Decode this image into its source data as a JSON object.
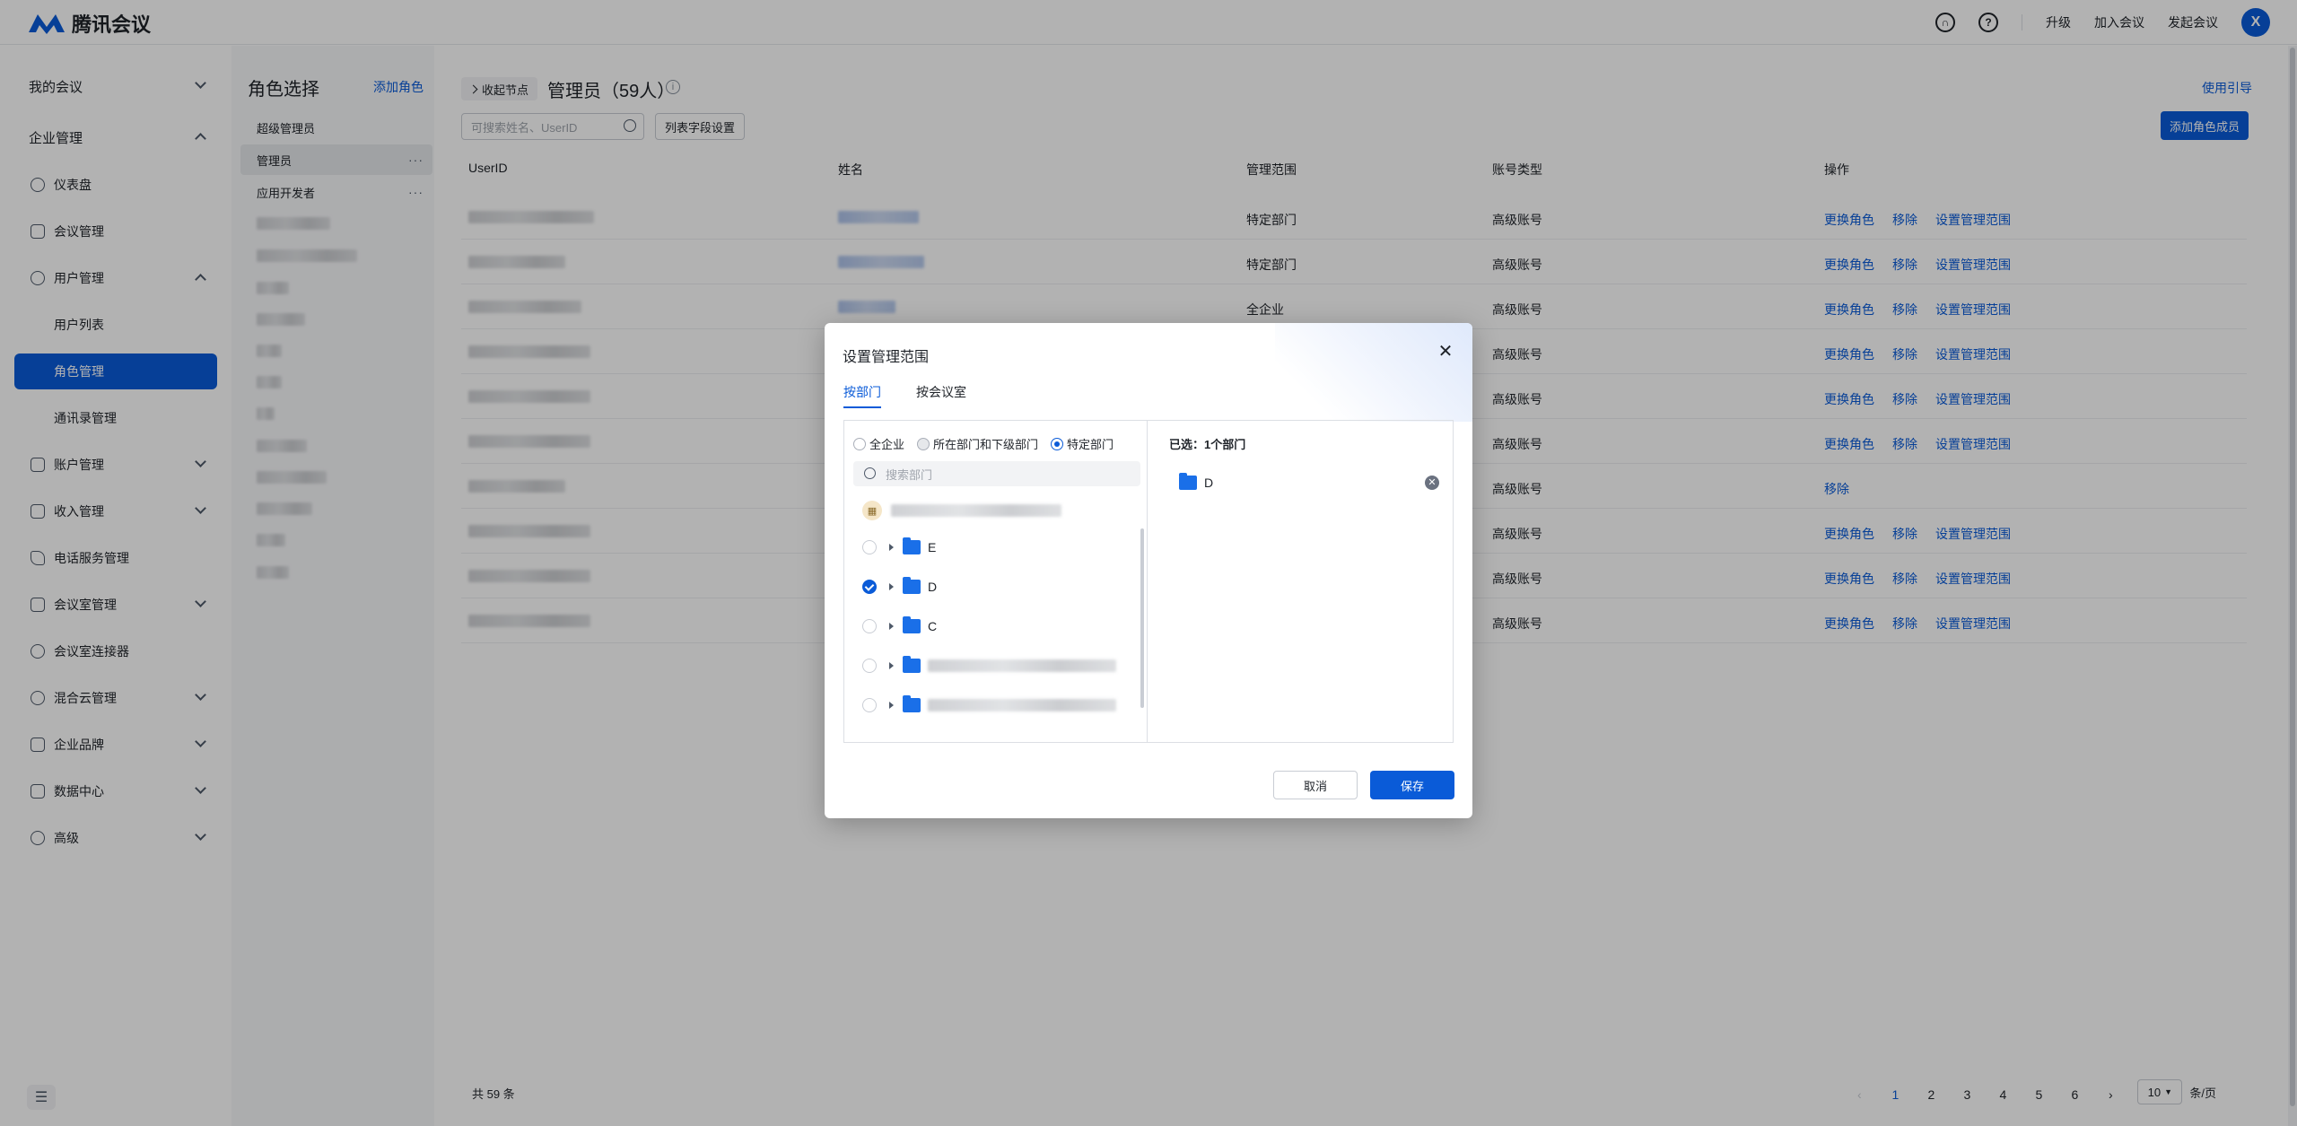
{
  "app": {
    "name": "腾讯会议",
    "brand_color": "#0a5bd8"
  },
  "topbar": {
    "icons": [
      "headset-icon",
      "help-icon"
    ],
    "upgrade": "升级",
    "join_meeting": "加入会议",
    "start_meeting": "发起会议",
    "avatar_letter": "X"
  },
  "sidebar": {
    "my_meetings": "我的会议",
    "enterprise_mgmt": "企业管理",
    "items": [
      {
        "label": "仪表盘",
        "icon": "dashboard-icon"
      },
      {
        "label": "会议管理",
        "icon": "list-icon"
      },
      {
        "label": "用户管理",
        "icon": "user-icon"
      },
      {
        "label": "用户列表"
      },
      {
        "label": "角色管理"
      },
      {
        "label": "通讯录管理"
      },
      {
        "label": "账户管理",
        "icon": "account-icon"
      },
      {
        "label": "收入管理",
        "icon": "income-icon"
      },
      {
        "label": "电话服务管理",
        "icon": "phone-icon"
      },
      {
        "label": "会议室管理",
        "icon": "room-icon"
      },
      {
        "label": "会议室连接器",
        "icon": "link-icon"
      },
      {
        "label": "混合云管理",
        "icon": "cloud-icon"
      },
      {
        "label": "企业品牌",
        "icon": "brand-icon"
      },
      {
        "label": "数据中心",
        "icon": "data-icon"
      },
      {
        "label": "高级",
        "icon": "advanced-icon"
      }
    ]
  },
  "roles": {
    "title": "角色选择",
    "add": "添加角色",
    "items": [
      "超级管理员",
      "管理员",
      "应用开发者"
    ]
  },
  "main": {
    "collapse_node": "收起节点",
    "title": "管理员（59人）",
    "use_guide": "使用引导",
    "search_placeholder": "可搜索姓名、UserID",
    "field_settings": "列表字段设置",
    "add_member": "添加角色成员",
    "columns": [
      "UserID",
      "姓名",
      "管理范围",
      "账号类型",
      "操作"
    ],
    "rows": [
      {
        "scope": "特定部门",
        "type": "高级账号",
        "ops": [
          "更换角色",
          "移除",
          "设置管理范围"
        ]
      },
      {
        "scope": "特定部门",
        "type": "高级账号",
        "ops": [
          "更换角色",
          "移除",
          "设置管理范围"
        ]
      },
      {
        "scope": "全企业",
        "type": "高级账号",
        "ops": [
          "更换角色",
          "移除",
          "设置管理范围"
        ]
      },
      {
        "scope": "",
        "type": "高级账号",
        "ops": [
          "更换角色",
          "移除",
          "设置管理范围"
        ]
      },
      {
        "scope": "",
        "type": "高级账号",
        "ops": [
          "更换角色",
          "移除",
          "设置管理范围"
        ]
      },
      {
        "scope": "",
        "type": "高级账号",
        "ops": [
          "更换角色",
          "移除",
          "设置管理范围"
        ]
      },
      {
        "scope": "",
        "type": "高级账号",
        "ops": [
          "移除"
        ]
      },
      {
        "scope": "",
        "type": "高级账号",
        "ops": [
          "更换角色",
          "移除",
          "设置管理范围"
        ]
      },
      {
        "scope": "",
        "type": "高级账号",
        "ops": [
          "更换角色",
          "移除",
          "设置管理范围"
        ]
      },
      {
        "scope": "",
        "type": "高级账号",
        "ops": [
          "更换角色",
          "移除",
          "设置管理范围"
        ]
      }
    ],
    "total": "共 59 条",
    "pages": [
      "1",
      "2",
      "3",
      "4",
      "5",
      "6"
    ],
    "current_page": "1",
    "page_size": "10",
    "per_page": "条/页"
  },
  "modal": {
    "title": "设置管理范围",
    "tabs": [
      "按部门",
      "按会议室"
    ],
    "radios": [
      "全企业",
      "所在部门和下级部门",
      "特定部门"
    ],
    "search_placeholder": "搜索部门",
    "tree": [
      {
        "name": "E",
        "checked": false
      },
      {
        "name": "D",
        "checked": true
      },
      {
        "name": "C",
        "checked": false
      },
      {
        "name": "",
        "checked": false
      },
      {
        "name": "",
        "checked": false
      }
    ],
    "selected_label": "已选：1个部门",
    "selected_items": [
      "D"
    ],
    "cancel": "取消",
    "save": "保存"
  }
}
